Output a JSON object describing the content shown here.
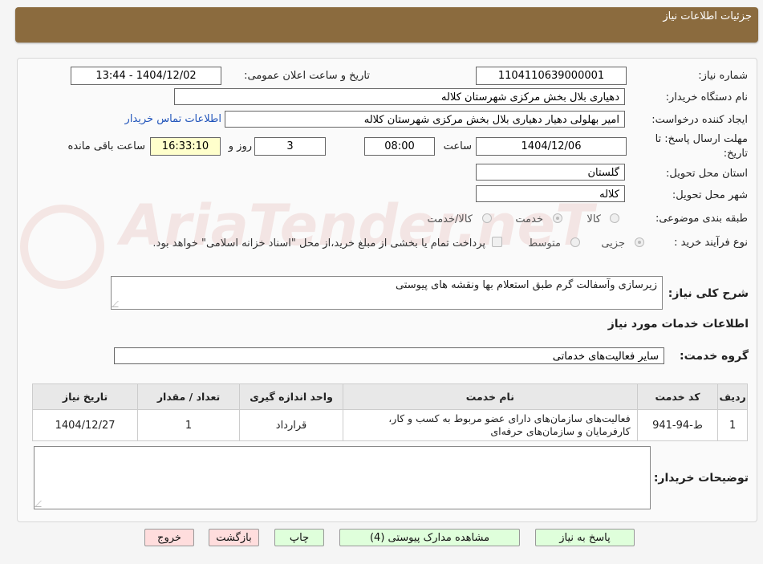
{
  "header": {
    "title": "جزئیات اطلاعات نیاز"
  },
  "watermark": "AriaTender.neT",
  "form": {
    "need_number": {
      "label": "شماره نیاز:",
      "value": "1104110639000001"
    },
    "announce": {
      "label": "تاریخ و ساعت اعلان عمومی:",
      "value": "1404/12/02 - 13:44"
    },
    "buyer_org": {
      "label": "نام دستگاه خریدار:",
      "value": "دهیاری بلال بخش مرکزی شهرستان کلاله"
    },
    "requester": {
      "label": "ایجاد کننده درخواست:",
      "value": "امیر بهلولی دهیار دهیاری بلال بخش مرکزی شهرستان کلاله"
    },
    "contact_link": "اطلاعات تماس خریدار",
    "deadline": {
      "label_line1": "مهلت ارسال پاسخ: تا",
      "label_line2": "تاریخ:",
      "date": "1404/12/06",
      "time_label": "ساعت",
      "time": "08:00",
      "days": "3",
      "days_label": "روز و",
      "remaining": "16:33:10",
      "remaining_label": "ساعت باقی مانده"
    },
    "province": {
      "label": "استان محل تحویل:",
      "value": "گلستان"
    },
    "city": {
      "label": "شهر محل تحویل:",
      "value": "کلاله"
    },
    "category": {
      "label": "طبقه بندی موضوعی:",
      "options": [
        "کالا",
        "خدمت",
        "کالا/خدمت"
      ],
      "selected": "خدمت"
    },
    "purchase_type": {
      "label": "نوع فرآیند خرید :",
      "options": [
        "جزیی",
        "متوسط"
      ],
      "selected": "جزیی",
      "note": "پرداخت تمام یا بخشی از مبلغ خرید،از محل \"اسناد خزانه اسلامی\" خواهد بود."
    },
    "description": {
      "label": "شرح کلی نیاز:",
      "value": "زیرسازی وآسفالت گرم طبق استعلام بها ونقشه های پیوستی"
    }
  },
  "services": {
    "section_title": "اطلاعات خدمات مورد نیاز",
    "group_label": "گروه خدمت:",
    "group_value": "سایر فعالیت‌های خدماتی",
    "columns": [
      "ردیف",
      "کد خدمت",
      "نام خدمت",
      "واحد اندازه گیری",
      "تعداد / مقدار",
      "تاریخ نیاز"
    ],
    "rows": [
      [
        "1",
        "ط-94-941",
        "فعالیت‌های سازمان‌های دارای عضو مربوط به کسب و کار، کارفرمایان و سازمان‌های حرفه‌ای",
        "قرارداد",
        "1",
        "1404/12/27"
      ]
    ]
  },
  "buyer_notes": {
    "label": "توضیحات خریدار:",
    "value": ""
  },
  "buttons": {
    "reply": "پاسخ به نیاز",
    "attachments": "مشاهده مدارک پیوستی (4)",
    "print": "چاپ",
    "back": "بازگشت",
    "exit": "خروج"
  }
}
